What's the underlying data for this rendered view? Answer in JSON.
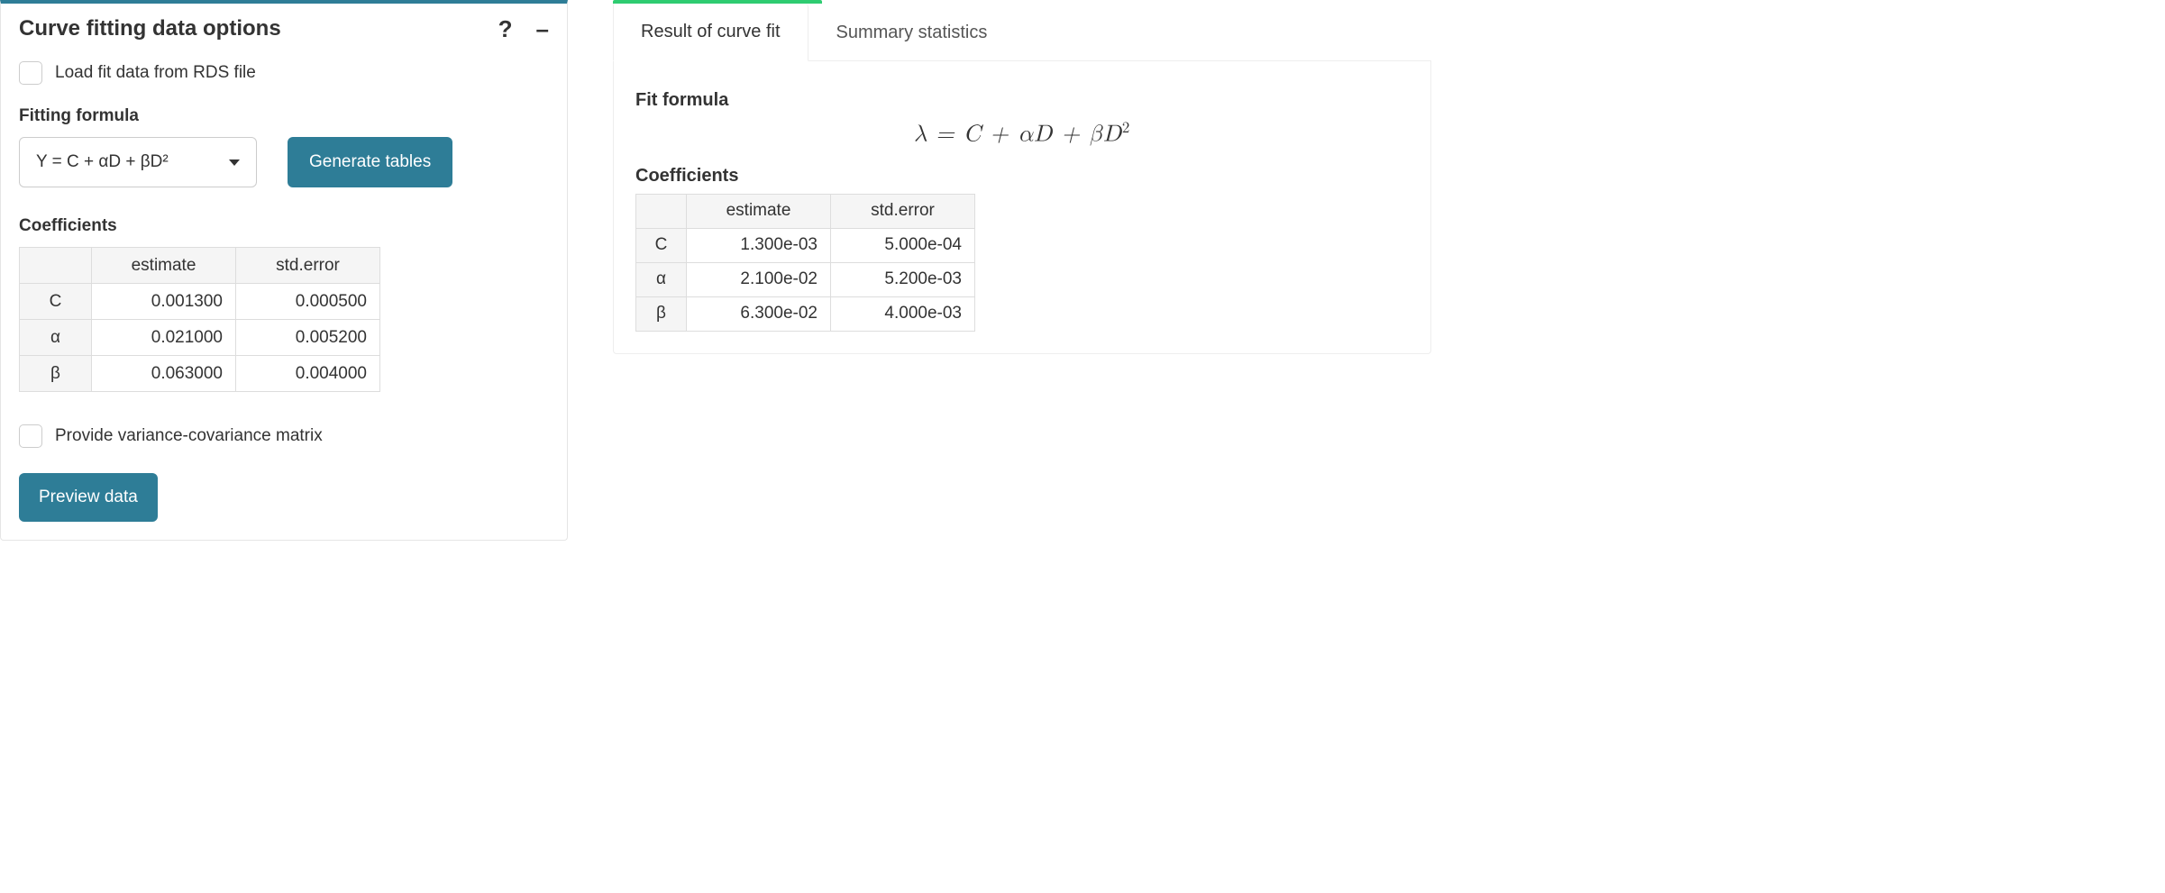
{
  "left": {
    "title": "Curve fitting data options",
    "icons": {
      "help": "?",
      "collapse": "–"
    },
    "load_from_rds_label": "Load fit data from RDS file",
    "fitting_formula_label": "Fitting formula",
    "formula_selected": "Y = C + αD + βD²",
    "generate_button": "Generate tables",
    "coefficients_label": "Coefficients",
    "coef_headers": {
      "estimate": "estimate",
      "stderr": "std.error"
    },
    "coef_rows": [
      {
        "param": "C",
        "estimate": "0.001300",
        "stderr": "0.000500"
      },
      {
        "param": "α",
        "estimate": "0.021000",
        "stderr": "0.005200"
      },
      {
        "param": "β",
        "estimate": "0.063000",
        "stderr": "0.004000"
      }
    ],
    "provide_varcov_label": "Provide variance-covariance matrix",
    "preview_button": "Preview data"
  },
  "right": {
    "tabs": {
      "active": "Result of curve fit",
      "inactive": "Summary statistics"
    },
    "fit_formula_label": "Fit formula",
    "fit_formula_html": "λ = C + αD + βD",
    "fit_formula_sup": "2",
    "coefficients_label": "Coefficients",
    "coef_headers": {
      "estimate": "estimate",
      "stderr": "std.error"
    },
    "coef_rows": [
      {
        "param": "C",
        "estimate": "1.300e-03",
        "stderr": "5.000e-04"
      },
      {
        "param": "α",
        "estimate": "2.100e-02",
        "stderr": "5.200e-03"
      },
      {
        "param": "β",
        "estimate": "6.300e-02",
        "stderr": "4.000e-03"
      }
    ]
  },
  "colors": {
    "teal": "#2e7d97",
    "green": "#2ecc71"
  }
}
